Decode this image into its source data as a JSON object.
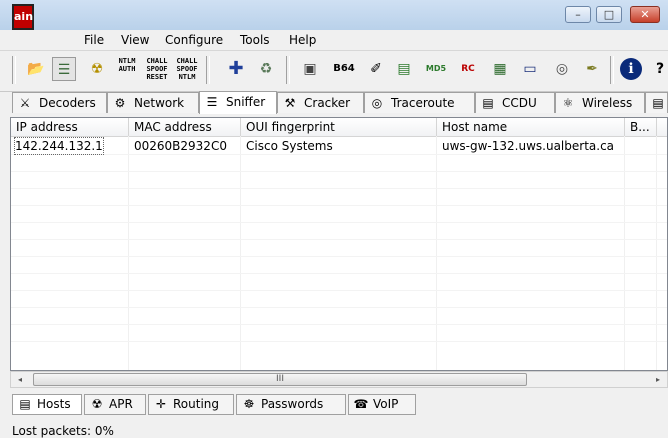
{
  "window": {
    "logo_text": "ain",
    "controls": {
      "minimize": "–",
      "maximize": "□",
      "close": "✕"
    }
  },
  "menu": [
    "File",
    "View",
    "Configure",
    "Tools",
    "Help"
  ],
  "toolbar": {
    "buttons": [
      {
        "name": "open-folder-icon",
        "glyph": "📂"
      },
      {
        "name": "sniffer-card-icon",
        "glyph": "☰"
      },
      {
        "name": "radiation-icon",
        "glyph": "☢"
      },
      {
        "name": "ntlm-auth-button",
        "glyph": "NTLM\nAUTH"
      },
      {
        "name": "chall-spoof-reset-button",
        "glyph": "CHALL\nSPOOF\nRESET"
      },
      {
        "name": "chall-spoof-ntlm-button",
        "glyph": "CHALL\nSPOOF\nNTLM"
      },
      {
        "name": "add-icon",
        "glyph": "✚"
      },
      {
        "name": "recycle-icon",
        "glyph": "♻"
      },
      {
        "name": "dialog-icon",
        "glyph": "▣"
      },
      {
        "name": "base64-icon",
        "glyph": "B64"
      },
      {
        "name": "hash-icon",
        "glyph": "✐"
      },
      {
        "name": "monitor-icon",
        "glyph": "▤"
      },
      {
        "name": "md5-icon",
        "glyph": "MD5"
      },
      {
        "name": "rc-icon",
        "glyph": "RC"
      },
      {
        "name": "calculator-icon",
        "glyph": "▦"
      },
      {
        "name": "card-icon",
        "glyph": "▭"
      },
      {
        "name": "globe-icon",
        "glyph": "◎"
      },
      {
        "name": "key-icon",
        "glyph": "✒"
      },
      {
        "name": "info-icon",
        "glyph": "ℹ"
      },
      {
        "name": "help-icon",
        "glyph": "?"
      }
    ]
  },
  "tabs": [
    {
      "label": "Decoders",
      "icon": "⚔"
    },
    {
      "label": "Network",
      "icon": "⚙"
    },
    {
      "label": "Sniffer",
      "icon": "☰"
    },
    {
      "label": "Cracker",
      "icon": "⚒"
    },
    {
      "label": "Traceroute",
      "icon": "◎"
    },
    {
      "label": "CCDU",
      "icon": "▤"
    },
    {
      "label": "Wireless",
      "icon": "⚛"
    }
  ],
  "table": {
    "columns": [
      "IP address",
      "MAC address",
      "OUI fingerprint",
      "Host name",
      "B..."
    ],
    "rows": [
      {
        "ip": "142.244.132.1",
        "mac": "00260B2932C0",
        "oui": "Cisco Systems",
        "host": "uws-gw-132.uws.ualberta.ca"
      }
    ]
  },
  "scrollbar": {
    "grip": "III",
    "left_arrow": "◂",
    "right_arrow": "▸"
  },
  "bottom_tabs": [
    {
      "label": "Hosts",
      "icon": "▤"
    },
    {
      "label": "APR",
      "icon": "☢"
    },
    {
      "label": "Routing",
      "icon": "✛"
    },
    {
      "label": "Passwords",
      "icon": "☸"
    },
    {
      "label": "VoIP",
      "icon": "☎"
    }
  ],
  "status": {
    "lost_packets": "Lost packets:  0%"
  }
}
